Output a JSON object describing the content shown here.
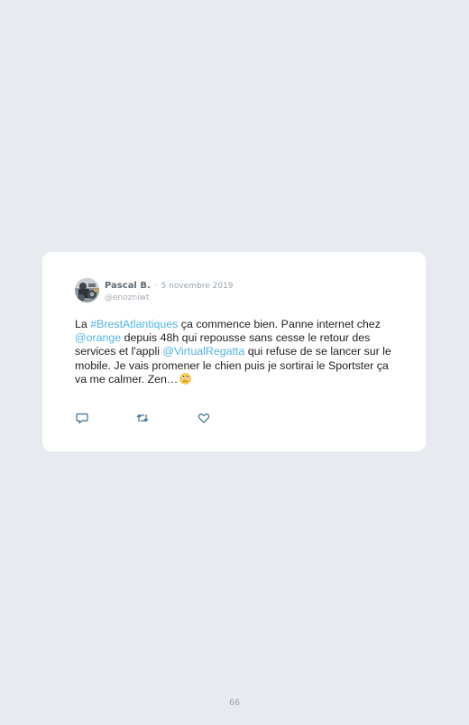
{
  "tweet": {
    "author_name": "Pascal B.",
    "separator": "·",
    "date": "5 novembre 2019",
    "handle": "@enozniwt",
    "text_parts": {
      "p1": "La ",
      "hashtag": "#BrestAtlantiques",
      "p2": " ça commence bien. Panne internet chez ",
      "mention1": "@orange",
      "p3": " depuis 48h qui repousse sans cesse le retour des services et l'appli ",
      "mention2": "@VirtualRegatta",
      "p4": " qui refuse de se lancer sur le mobile. Je vais promener le chien puis je sortirai le Sportster ça va me calmer. Zen…"
    },
    "emoji": "face-with-rolling-eyes",
    "actions": [
      "reply-icon",
      "retweet-icon",
      "like-icon"
    ]
  },
  "colors": {
    "background": "#e7eaee",
    "card": "#ffffff",
    "link": "#4fb3e6",
    "name": "#5f6b76",
    "muted": "#9aa4ad"
  },
  "page_number": "66"
}
